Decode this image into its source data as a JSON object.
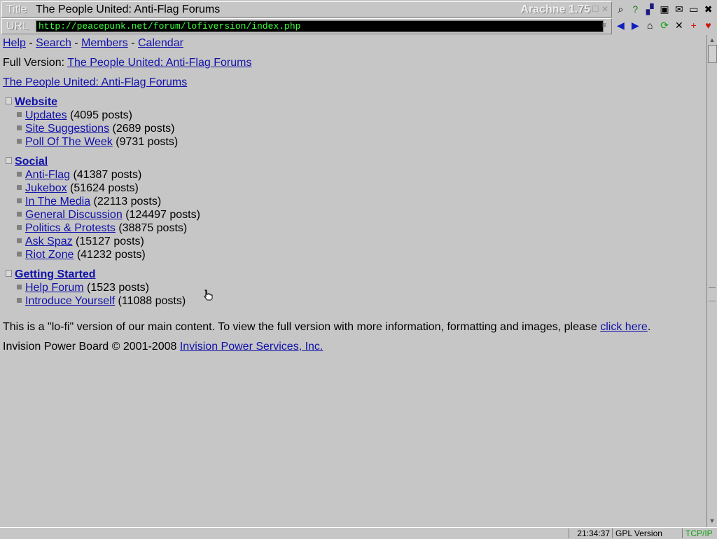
{
  "window": {
    "title_label": "Title",
    "title": "The People United: Anti-Flag Forums",
    "app_name": "Arachne 1.75",
    "url_label": "URL",
    "url": "http://peacepunk.net/forum/lofiversion/index.php"
  },
  "toolbar": {
    "row1": [
      {
        "icon": "search-icon",
        "glyph": "⌕",
        "color": "#000000"
      },
      {
        "icon": "help-icon",
        "glyph": "?",
        "color": "#1a7f1a"
      },
      {
        "icon": "stats-icon",
        "glyph": "▞",
        "color": "#1a1a80"
      },
      {
        "icon": "save-icon",
        "glyph": "▣",
        "color": "#000000"
      },
      {
        "icon": "mail-icon",
        "glyph": "✉",
        "color": "#000000"
      },
      {
        "icon": "window-icon",
        "glyph": "▭",
        "color": "#000000"
      },
      {
        "icon": "close-app-icon",
        "glyph": "✖",
        "color": "#000000"
      }
    ],
    "row2": [
      {
        "icon": "back-icon",
        "glyph": "◀",
        "color": "#1020c0"
      },
      {
        "icon": "forward-icon",
        "glyph": "▶",
        "color": "#1020c0"
      },
      {
        "icon": "home-icon",
        "glyph": "⌂",
        "color": "#000000"
      },
      {
        "icon": "reload-icon",
        "glyph": "⟳",
        "color": "#10a010"
      },
      {
        "icon": "stop-icon",
        "glyph": "✕",
        "color": "#000000"
      },
      {
        "icon": "add-icon",
        "glyph": "+",
        "color": "#d01010"
      },
      {
        "icon": "favorite-icon",
        "glyph": "♥",
        "color": "#d01010"
      }
    ]
  },
  "nav": {
    "help": "Help",
    "sep1": "-",
    "search": "Search",
    "sep2": "-",
    "members": "Members",
    "sep3": "-",
    "calendar": "Calendar"
  },
  "full_version": {
    "label": "Full Version:",
    "link": "The People United: Anti-Flag Forums"
  },
  "board_link": "The People United: Anti-Flag Forums",
  "categories": [
    {
      "name": "Website",
      "forums": [
        {
          "name": "Updates",
          "posts": "(4095 posts)"
        },
        {
          "name": "Site Suggestions",
          "posts": "(2689 posts)"
        },
        {
          "name": "Poll Of The Week",
          "posts": "(9731 posts)"
        }
      ]
    },
    {
      "name": "Social",
      "forums": [
        {
          "name": "Anti-Flag",
          "posts": "(41387 posts)"
        },
        {
          "name": "Jukebox",
          "posts": "(51624 posts)"
        },
        {
          "name": "In The Media",
          "posts": "(22113 posts)"
        },
        {
          "name": "General Discussion",
          "posts": "(124497 posts)"
        },
        {
          "name": "Politics & Protests",
          "posts": "(38875 posts)"
        },
        {
          "name": "Ask Spaz",
          "posts": "(15127 posts)"
        },
        {
          "name": "Riot Zone",
          "posts": "(41232 posts)"
        }
      ]
    },
    {
      "name": "Getting Started",
      "forums": [
        {
          "name": "Help Forum",
          "posts": "(1523 posts)"
        },
        {
          "name": "Introduce Yourself",
          "posts": "(11088 posts)"
        }
      ]
    }
  ],
  "footer": {
    "lofi_text": "This is a \"lo-fi\" version of our main content. To view the full version with more information, formatting and images, please",
    "click_here": "click here",
    "period": ".",
    "copyright": "Invision Power Board © 2001-2008",
    "company_link": "Invision Power Services, Inc."
  },
  "status": {
    "time": "21:34:37",
    "license": "GPL  Version",
    "protocol": "TCP/IP"
  },
  "colors": {
    "link": "#1111aa",
    "chrome": "#c6c6c6",
    "url_text": "#3cff3c",
    "tcpip": "#10a010"
  }
}
